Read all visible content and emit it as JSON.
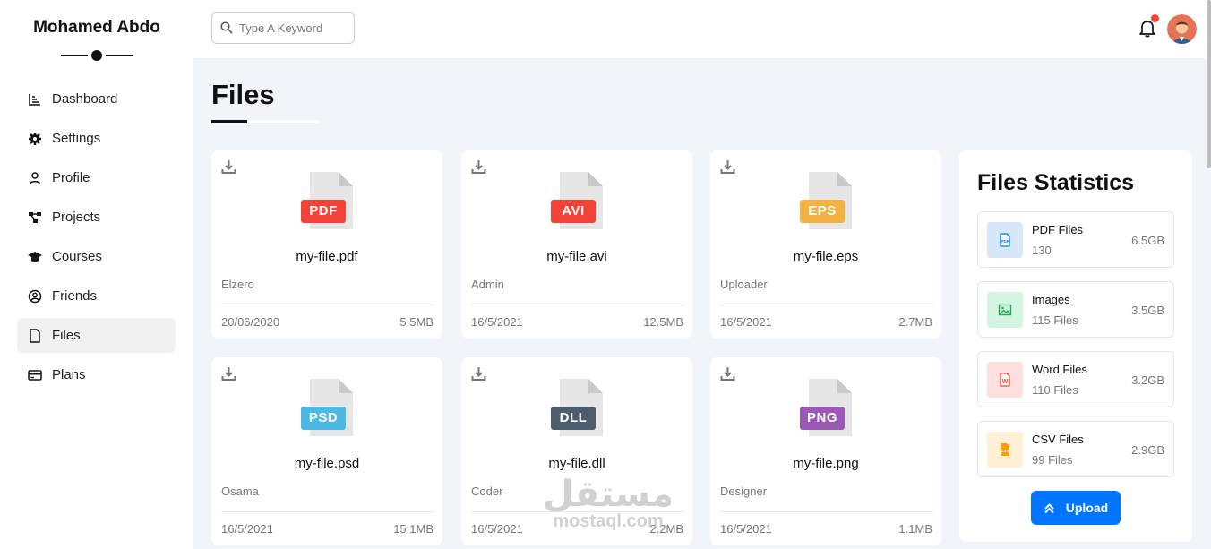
{
  "sidebar": {
    "brand": "Mohamed Abdo",
    "items": [
      {
        "label": "Dashboard",
        "icon": "chart-icon"
      },
      {
        "label": "Settings",
        "icon": "gear-icon"
      },
      {
        "label": "Profile",
        "icon": "user-icon"
      },
      {
        "label": "Projects",
        "icon": "diagram-icon"
      },
      {
        "label": "Courses",
        "icon": "graduation-cap-icon"
      },
      {
        "label": "Friends",
        "icon": "user-circle-icon"
      },
      {
        "label": "Files",
        "icon": "file-icon",
        "active": true
      },
      {
        "label": "Plans",
        "icon": "credit-card-icon"
      }
    ]
  },
  "topbar": {
    "search_placeholder": "Type A Keyword",
    "notification": true
  },
  "main": {
    "title": "Files",
    "files": [
      {
        "ext": "PDF",
        "color": "#f44336",
        "name": "my-file.pdf",
        "uploader": "Elzero",
        "date": "20/06/2020",
        "size": "5.5MB"
      },
      {
        "ext": "AVI",
        "color": "#f44336",
        "name": "my-file.avi",
        "uploader": "Admin",
        "date": "16/5/2021",
        "size": "12.5MB"
      },
      {
        "ext": "EPS",
        "color": "#f5b240",
        "name": "my-file.eps",
        "uploader": "Uploader",
        "date": "16/5/2021",
        "size": "2.7MB"
      },
      {
        "ext": "PSD",
        "color": "#4bb9e3",
        "name": "my-file.psd",
        "uploader": "Osama",
        "date": "16/5/2021",
        "size": "15.1MB"
      },
      {
        "ext": "DLL",
        "color": "#4c5c6e",
        "name": "my-file.dll",
        "uploader": "Coder",
        "date": "16/5/2021",
        "size": "2.2MB"
      },
      {
        "ext": "PNG",
        "color": "#9b59b6",
        "name": "my-file.png",
        "uploader": "Designer",
        "date": "16/5/2021",
        "size": "1.1MB"
      }
    ]
  },
  "stats": {
    "title": "Files Statistics",
    "items": [
      {
        "name": "PDF Files",
        "count": "130",
        "size": "6.5GB",
        "icon": "pdf-file-icon",
        "bg": "#d7e8fb",
        "fg": "#0075ff"
      },
      {
        "name": "Images",
        "count": "115 Files",
        "size": "3.5GB",
        "icon": "image-icon",
        "bg": "#d5f5e3",
        "fg": "#22a85a"
      },
      {
        "name": "Word Files",
        "count": "110 Files",
        "size": "3.2GB",
        "icon": "word-file-icon",
        "bg": "#fde1e1",
        "fg": "#f44336"
      },
      {
        "name": "CSV Files",
        "count": "99 Files",
        "size": "2.9GB",
        "icon": "csv-file-icon",
        "bg": "#fdf0d5",
        "fg": "#f59e0b"
      }
    ],
    "upload_label": "Upload"
  },
  "watermark": {
    "arabic": "مستقل",
    "latin": "mostaql.com"
  }
}
